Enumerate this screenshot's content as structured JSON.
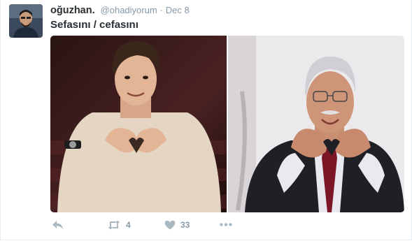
{
  "tweet": {
    "display_name": "oğuzhan.",
    "handle": "@ohadiyorum",
    "separator": "·",
    "timestamp": "Dec 8",
    "text": "Sefasını / cefasını"
  },
  "actions": {
    "retweet_count": "4",
    "like_count": "33"
  },
  "icons": {
    "reply": "reply-icon",
    "retweet": "retweet-icon",
    "like": "heart-icon",
    "more": "more-icon"
  },
  "colors": {
    "name": "#292f33",
    "meta": "#8899a6",
    "action_icon": "#aab8c2"
  }
}
